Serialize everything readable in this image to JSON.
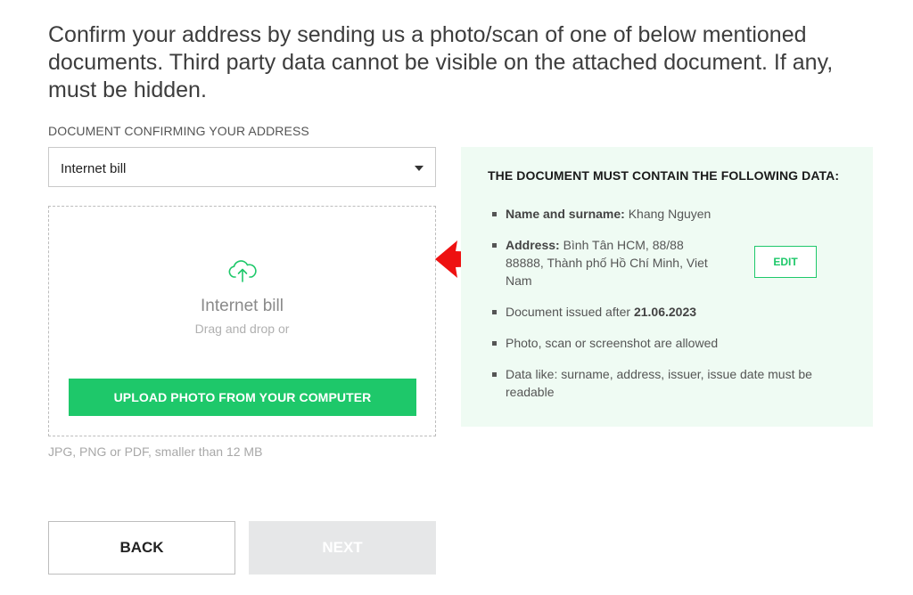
{
  "intro": {
    "text": "Confirm your address by sending us a photo/scan of one of below mentioned documents. Third party data cannot be visible on the attached document. If any, must be hidden."
  },
  "document_select": {
    "label": "DOCUMENT CONFIRMING YOUR ADDRESS",
    "selected": "Internet bill",
    "icon": "chevron-down-icon"
  },
  "dropzone": {
    "icon": "cloud-upload-icon",
    "title": "Internet bill",
    "subtitle": "Drag and drop or",
    "upload_button": "UPLOAD PHOTO FROM YOUR COMPUTER",
    "accent_color": "#1ec86a"
  },
  "formats_hint": "JPG, PNG or PDF, smaller than 12 MB",
  "annotation": {
    "icon": "red-arrow-icon",
    "color": "#ee1111"
  },
  "requirements": {
    "title": "THE DOCUMENT MUST CONTAIN THE FOLLOWING DATA:",
    "background": "#effbf3",
    "items": [
      {
        "label": "Name and surname:",
        "value": "Khang Nguyen"
      },
      {
        "label": "Address:",
        "value_line1": "Bình Tân HCM, 88/88",
        "value_line2": "88888, Thành phố Hồ Chí Minh, Viet",
        "value_line3": "Nam"
      },
      {
        "prefix": "Document issued after",
        "date": "21.06.2023"
      },
      {
        "text": "Photo, scan or screenshot are allowed"
      },
      {
        "text_line1": "Data like: surname, address, issuer, issue date must be",
        "text_line2": "readable"
      }
    ],
    "edit_button": "EDIT"
  },
  "footer": {
    "back": "BACK",
    "next": "NEXT",
    "next_disabled": true
  }
}
